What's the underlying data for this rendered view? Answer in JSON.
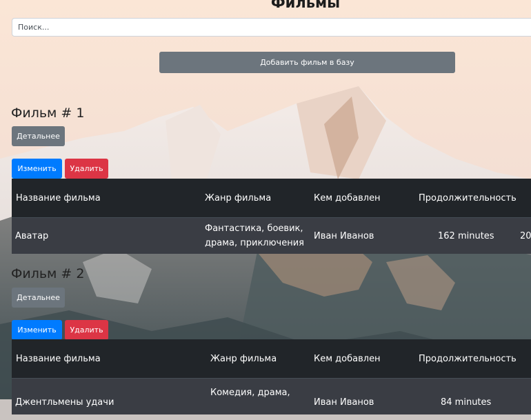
{
  "header": {
    "title": "Фильмы"
  },
  "search": {
    "placeholder": "Поиск..."
  },
  "add_button_label": "Добавить фильм в базу",
  "columns": [
    "Название фильма",
    "Жанр фильма",
    "Кем добавлен",
    "Продолжительность"
  ],
  "films": [
    {
      "heading": "Фильм # 1",
      "details_label": "Детальнее",
      "edit_label": "Изменить",
      "delete_label": "Удалить",
      "name": "Аватар",
      "genre_line1": "Фантастика, боевик,",
      "genre_line2": "драма, приключения",
      "added_by": "Иван Иванов",
      "duration": "162 minutes",
      "extra": "20"
    },
    {
      "heading": "Фильм # 2",
      "details_label": "Детальнее",
      "edit_label": "Изменить",
      "delete_label": "Удалить",
      "name": "Джентльмены удачи",
      "genre_line1": "Комедия, драма,",
      "genre_line2": "",
      "added_by": "Иван Иванов",
      "duration": "84 minutes",
      "extra": ""
    }
  ]
}
